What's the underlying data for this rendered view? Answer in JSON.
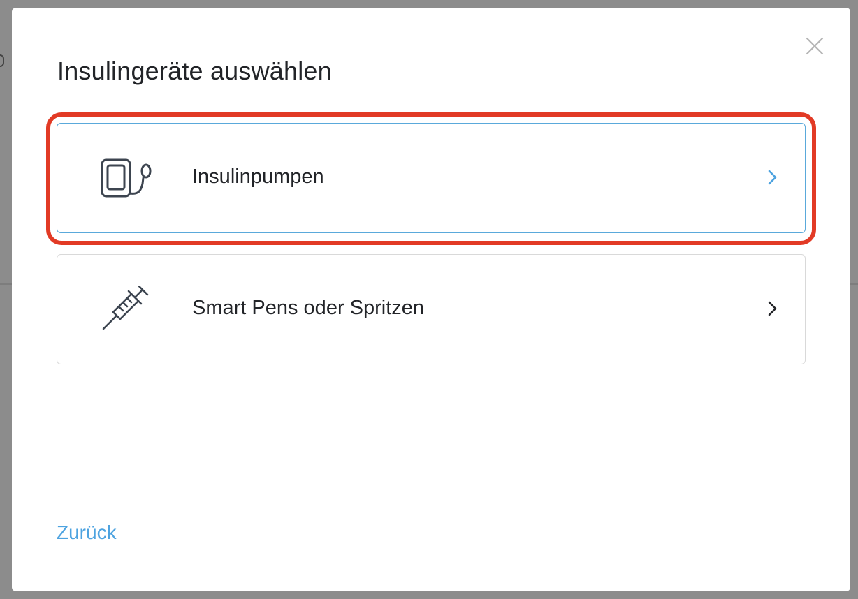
{
  "modal": {
    "title": "Insulingeräte auswählen",
    "close_icon": "close-icon",
    "options": [
      {
        "label": "Insulinpumpen",
        "icon": "insulin-pump-icon",
        "chevron_color": "#4da3e0",
        "border_color": "#5aa9db",
        "highlighted": true
      },
      {
        "label": "Smart Pens oder Spritzen",
        "icon": "syringe-icon",
        "chevron_color": "#222428",
        "border_color": "#d9d9d9",
        "highlighted": false
      }
    ],
    "back_label": "Zurück"
  },
  "colors": {
    "accent": "#4da3e0",
    "highlight": "#e23a25",
    "text": "#222428",
    "icon": "#3d4550"
  }
}
